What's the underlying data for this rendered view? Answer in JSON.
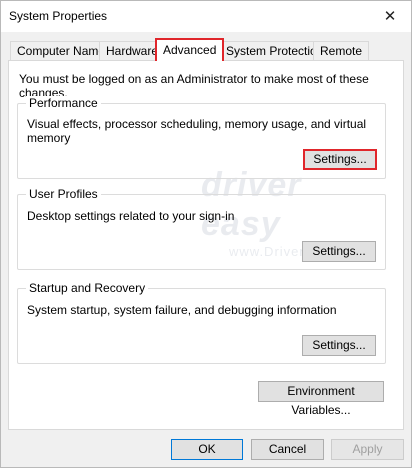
{
  "window": {
    "title": "System Properties",
    "close_label": "✕"
  },
  "tabs": [
    {
      "label": "Computer Name",
      "active": false
    },
    {
      "label": "Hardware",
      "active": false
    },
    {
      "label": "Advanced",
      "active": true
    },
    {
      "label": "System Protection",
      "active": false
    },
    {
      "label": "Remote",
      "active": false
    }
  ],
  "notice": "You must be logged on as an Administrator to make most of these changes.",
  "groups": {
    "performance": {
      "title": "Performance",
      "description": "Visual effects, processor scheduling, memory usage, and virtual memory",
      "button": "Settings..."
    },
    "user_profiles": {
      "title": "User Profiles",
      "description": "Desktop settings related to your sign-in",
      "button": "Settings..."
    },
    "startup_recovery": {
      "title": "Startup and Recovery",
      "description": "System startup, system failure, and debugging information",
      "button": "Settings..."
    }
  },
  "environment_button": "Environment Variables...",
  "footer": {
    "ok": "OK",
    "cancel": "Cancel",
    "apply": "Apply"
  },
  "watermark": {
    "brand": "driver easy",
    "url": "www.DriverEasy.com"
  },
  "colors": {
    "highlight": "#e0262b",
    "panel": "#ffffff",
    "chrome": "#f0f0f0"
  }
}
